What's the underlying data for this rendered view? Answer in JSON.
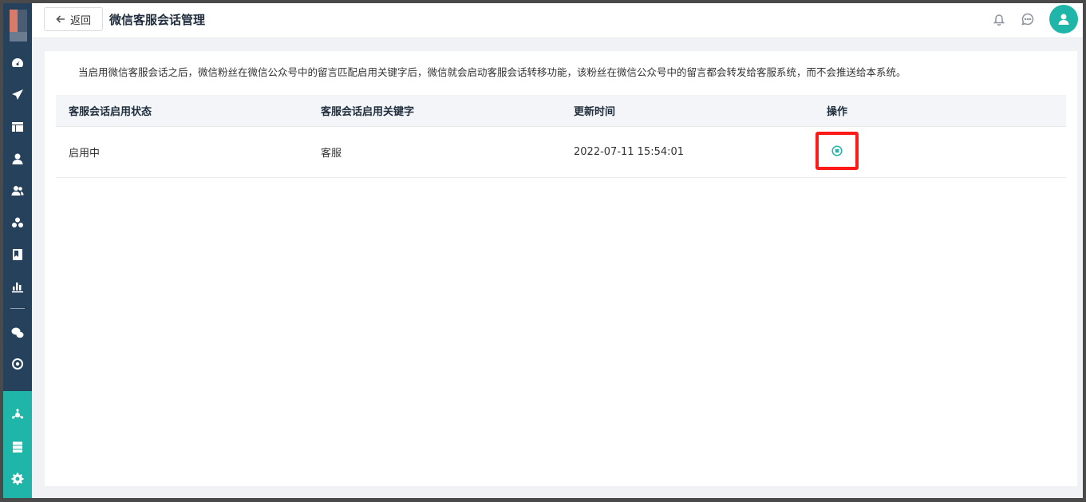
{
  "header": {
    "back_label": "返回",
    "title": "微信客服会话管理"
  },
  "icons": {
    "sidebar": [
      "dashboard-icon",
      "send-icon",
      "layout-icon",
      "user-icon",
      "users-icon",
      "group-icon",
      "bookmark-icon",
      "bar-chart-icon",
      "wechat-icon",
      "target-icon",
      "hub-icon",
      "server-icon",
      "gear-icon"
    ],
    "header": [
      "bell-icon",
      "chat-icon",
      "avatar-icon"
    ],
    "action": "stop-circle-icon"
  },
  "colors": {
    "sidebar": "#26415c",
    "accent": "#1fb5a8",
    "highlight": "#ff1a1a"
  },
  "notice": "当启用微信客服会话之后，微信粉丝在微信公众号中的留言匹配启用关键字后，微信就会启动客服会话转移功能，该粉丝在微信公众号中的留言都会转发给客服系统，而不会推送给本系统。",
  "table": {
    "headers": [
      "客服会话启用状态",
      "客服会话启用关键字",
      "更新时间",
      "操作"
    ],
    "rows": [
      {
        "status": "启用中",
        "keyword": "客服",
        "updated": "2022-07-11 15:54:01"
      }
    ]
  }
}
